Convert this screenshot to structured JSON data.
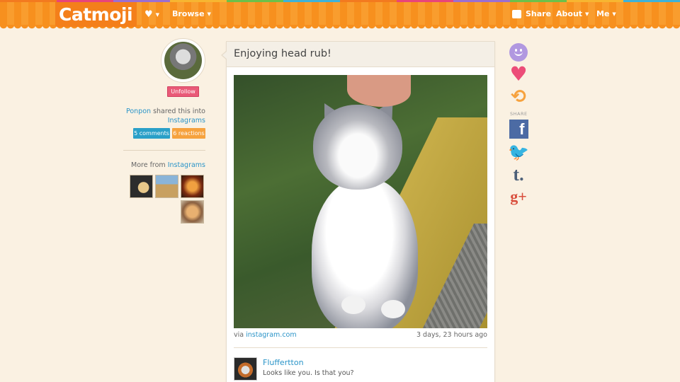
{
  "header": {
    "logo": "Catmoji",
    "browse_label": "Browse",
    "share_label": "Share",
    "about_label": "About",
    "me_label": "Me"
  },
  "sidebar": {
    "unfollow_label": "Unfollow",
    "user_name": "Ponpon",
    "shared_text": "shared this into",
    "collection": "Instagrams",
    "comments_badge": "5 comments",
    "reactions_badge": "6 reactions",
    "more_from_text": "More from",
    "more_from_collection": "Instagrams"
  },
  "post": {
    "title": "Enjoying head rub!",
    "via_text": "via",
    "source": "instagram.com",
    "timestamp": "3 days, 23 hours ago"
  },
  "comment": {
    "author": "Fluffertton",
    "text": "Looks like you. Is that you?"
  },
  "reactions": {
    "share_label": "SHARE",
    "icons": [
      "smiley-icon",
      "heart-icon",
      "retweet-icon",
      "facebook-icon",
      "twitter-icon",
      "tumblr-icon",
      "google-plus-icon"
    ]
  },
  "colors": {
    "header_orange": "#f7901e",
    "unfollow_pink": "#e95a78",
    "comments_blue": "#2aa0c8",
    "reactions_orange": "#f6a23e",
    "link_blue": "#2a94c8",
    "rainbow": [
      "#f37a1f",
      "#e8457a",
      "#9b6fd0",
      "#f7b531",
      "#6cc04a",
      "#3fb2d8",
      "#f37a1f",
      "#e8457a",
      "#9b6fd0",
      "#6cc04a",
      "#f7b531",
      "#3fb2d8"
    ]
  }
}
